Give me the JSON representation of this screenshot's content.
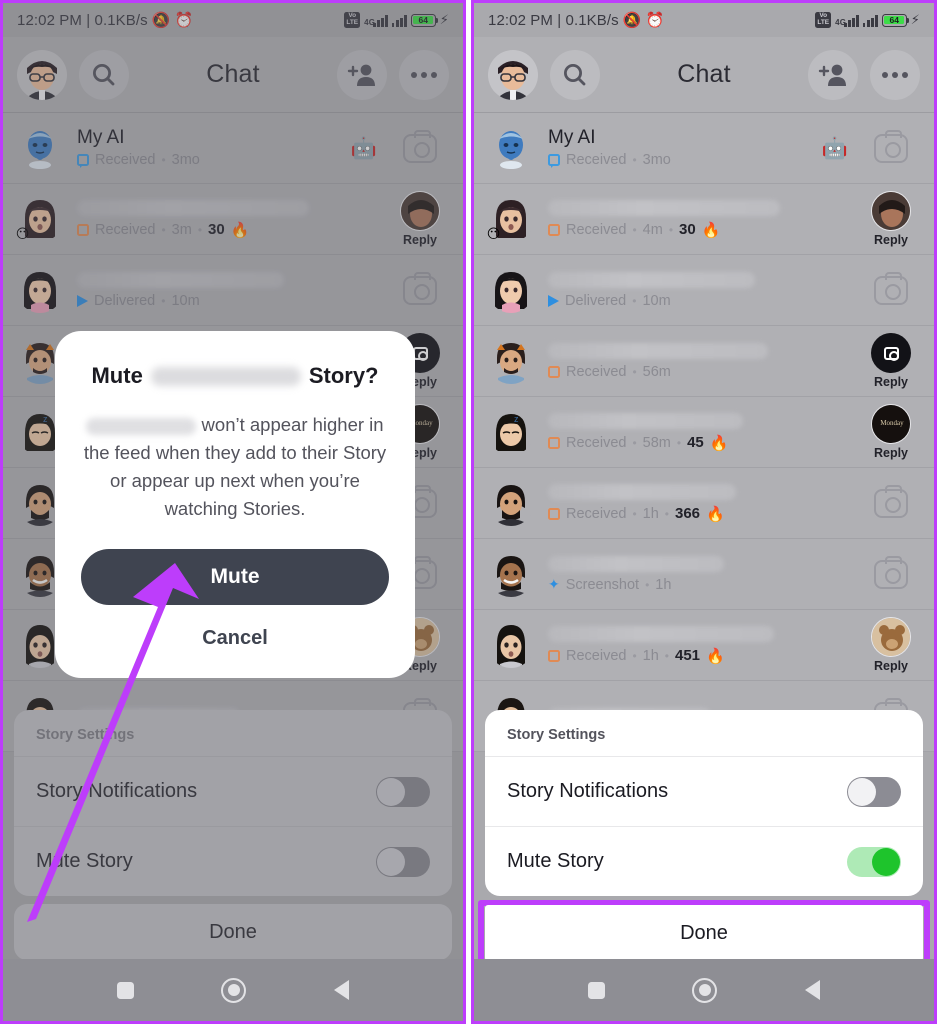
{
  "accent_purple": "#bd3dfb",
  "status_bar": {
    "time_and_data": "12:02 PM | 0.1KB/s",
    "mute_icon": "bell-muted-icon",
    "alarm_icon": "alarm-clock-icon",
    "volte_label": "VoLTE",
    "network_label": "4G",
    "network_sublabel": "4P",
    "battery_level": "64",
    "charging_icon": "lightning-bolt-icon"
  },
  "app_header": {
    "title": "Chat",
    "avatar_icon": "profile-bitmoji-avatar",
    "search_icon": "search-icon",
    "add_friend_icon": "add-friend-icon",
    "more_icon": "more-options-icon"
  },
  "left_panel": {
    "rows": [
      {
        "name": "My AI",
        "blurred": false,
        "status": "Received",
        "status_icon": "chat-bubble-icon",
        "time": "3mo",
        "streak": "",
        "action": "camera-outline",
        "action_label": "",
        "avatar": "my-ai-bitmoji",
        "badge": "",
        "trailing_icon": "robot-icon"
      },
      {
        "name": "",
        "blurred": true,
        "status": "Received",
        "status_icon": "snap-square-icon",
        "time": "3m",
        "streak": "30",
        "action": "story-ring",
        "action_label": "Reply",
        "avatar": "friend-bitmoji-1",
        "badge": "😶",
        "trailing_icon": ""
      },
      {
        "name": "",
        "blurred": true,
        "status": "Delivered",
        "status_icon": "sent-arrow-icon",
        "time": "10m",
        "streak": "",
        "action": "camera-outline",
        "action_label": "",
        "avatar": "friend-bitmoji-2",
        "badge": "",
        "trailing_icon": ""
      },
      {
        "name": "",
        "blurred": true,
        "status": "Received",
        "status_icon": "snap-square-icon",
        "time": "56m",
        "streak": "",
        "action": "camera-filled",
        "action_label": "Reply",
        "avatar": "friend-bitmoji-3",
        "badge": "",
        "trailing_icon": ""
      },
      {
        "name": "",
        "blurred": true,
        "status": "Received",
        "status_icon": "snap-square-icon",
        "time": "58m",
        "streak": "45",
        "action": "story-ring-dark",
        "action_label": "Reply",
        "avatar": "friend-bitmoji-4",
        "badge": "",
        "trailing_icon": ""
      },
      {
        "name": "",
        "blurred": true,
        "status": "Received",
        "status_icon": "snap-square-icon",
        "time": "1h",
        "streak": "366",
        "action": "camera-outline",
        "action_label": "",
        "avatar": "friend-bitmoji-5",
        "badge": "",
        "trailing_icon": ""
      },
      {
        "name": "",
        "blurred": true,
        "status": "Screenshot",
        "status_icon": "screenshot-icon",
        "time": "1h",
        "streak": "",
        "action": "camera-outline",
        "action_label": "",
        "avatar": "friend-bitmoji-6",
        "badge": "",
        "trailing_icon": ""
      },
      {
        "name": "",
        "blurred": true,
        "status": "Received",
        "status_icon": "snap-square-icon",
        "time": "1h",
        "streak": "451",
        "action": "story-ring-bear",
        "action_label": "Reply",
        "avatar": "friend-bitmoji-7",
        "badge": "",
        "trailing_icon": ""
      },
      {
        "name": "",
        "blurred": true,
        "status": "",
        "status_icon": "",
        "time": "",
        "streak": "",
        "action": "camera-outline",
        "action_label": "",
        "avatar": "friend-bitmoji-8",
        "badge": "",
        "trailing_icon": ""
      }
    ],
    "story_settings": {
      "title": "Story Settings",
      "items": [
        {
          "label": "Story Notifications",
          "toggle_state": "off"
        },
        {
          "label": "Mute Story",
          "toggle_state": "off"
        }
      ],
      "done_label": "Done"
    },
    "modal": {
      "title_prefix": "Mute",
      "title_suffix": "Story?",
      "body_suffix": "won’t appear higher in the feed when they add to their Story or appear up next when you’re watching Stories.",
      "primary_label": "Mute",
      "cancel_label": "Cancel"
    },
    "annotation": {
      "type": "arrow",
      "points_to": "Mute",
      "color": "#bd3dfb"
    }
  },
  "right_panel": {
    "rows": [
      {
        "name": "My AI",
        "blurred": false,
        "status": "Received",
        "status_icon": "chat-bubble-icon",
        "time": "3mo",
        "streak": "",
        "action": "camera-outline",
        "action_label": "",
        "avatar": "my-ai-bitmoji",
        "badge": "",
        "trailing_icon": "robot-icon"
      },
      {
        "name": "",
        "blurred": true,
        "status": "Received",
        "status_icon": "snap-square-icon",
        "time": "4m",
        "streak": "30",
        "action": "story-ring",
        "action_label": "Reply",
        "avatar": "friend-bitmoji-1",
        "badge": "😶",
        "trailing_icon": ""
      },
      {
        "name": "",
        "blurred": true,
        "status": "Delivered",
        "status_icon": "sent-arrow-icon",
        "time": "10m",
        "streak": "",
        "action": "camera-outline",
        "action_label": "",
        "avatar": "friend-bitmoji-2",
        "badge": "",
        "trailing_icon": ""
      },
      {
        "name": "",
        "blurred": true,
        "status": "Received",
        "status_icon": "snap-square-icon",
        "time": "56m",
        "streak": "",
        "action": "camera-filled",
        "action_label": "Reply",
        "avatar": "friend-bitmoji-3",
        "badge": "",
        "trailing_icon": ""
      },
      {
        "name": "",
        "blurred": true,
        "status": "Received",
        "status_icon": "snap-square-icon",
        "time": "58m",
        "streak": "45",
        "action": "story-ring-dark",
        "action_label": "Reply",
        "avatar": "friend-bitmoji-4",
        "badge": "",
        "trailing_icon": ""
      },
      {
        "name": "",
        "blurred": true,
        "status": "Received",
        "status_icon": "snap-square-icon",
        "time": "1h",
        "streak": "366",
        "action": "camera-outline",
        "action_label": "",
        "avatar": "friend-bitmoji-5",
        "badge": "",
        "trailing_icon": ""
      },
      {
        "name": "",
        "blurred": true,
        "status": "Screenshot",
        "status_icon": "screenshot-icon",
        "time": "1h",
        "streak": "",
        "action": "camera-outline",
        "action_label": "",
        "avatar": "friend-bitmoji-6",
        "badge": "",
        "trailing_icon": ""
      },
      {
        "name": "",
        "blurred": true,
        "status": "Received",
        "status_icon": "snap-square-icon",
        "time": "1h",
        "streak": "451",
        "action": "story-ring-bear",
        "action_label": "Reply",
        "avatar": "friend-bitmoji-7",
        "badge": "",
        "trailing_icon": ""
      },
      {
        "name": "",
        "blurred": true,
        "status": "",
        "status_icon": "",
        "time": "",
        "streak": "",
        "action": "camera-outline",
        "action_label": "",
        "avatar": "friend-bitmoji-8",
        "badge": "",
        "trailing_icon": ""
      }
    ],
    "story_settings": {
      "title": "Story Settings",
      "items": [
        {
          "label": "Story Notifications",
          "toggle_state": "off"
        },
        {
          "label": "Mute Story",
          "toggle_state": "on"
        }
      ],
      "done_label": "Done"
    },
    "annotation": {
      "type": "highlight-box",
      "target": "Done",
      "color": "#bd3dfb"
    }
  },
  "nav_bar": {
    "recents_icon": "square-recents-icon",
    "home_icon": "circle-home-icon",
    "back_icon": "triangle-back-icon"
  }
}
